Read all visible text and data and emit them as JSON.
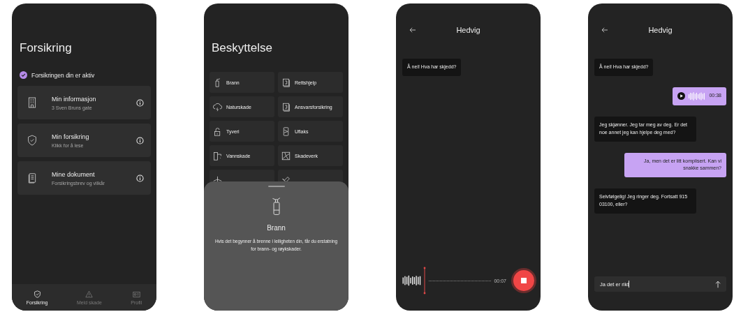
{
  "insurance_screen": {
    "title": "Forsikring",
    "status": {
      "label": "Forsikringen din er aktiv",
      "active": true
    },
    "cards": [
      {
        "title": "Min informasjon",
        "subtitle": "3 Sven Bruns gate"
      },
      {
        "title": "Min forsikring",
        "subtitle": "Klikk for å lese"
      },
      {
        "title": "Mine dokument",
        "subtitle": "Forsikringsbrev og vilkår"
      }
    ],
    "tabs": [
      {
        "label": "Forsikring",
        "selected": true
      },
      {
        "label": "Meld skade",
        "selected": false
      },
      {
        "label": "Profil",
        "selected": false
      }
    ]
  },
  "protection_screen": {
    "title": "Beskyttelse",
    "tiles": [
      {
        "label": "Brann"
      },
      {
        "label": "Rettshjelp"
      },
      {
        "label": "Naturskade"
      },
      {
        "label": "Ansvarsforsikring"
      },
      {
        "label": "Tyveri"
      },
      {
        "label": "Uflaks"
      },
      {
        "label": "Vannskade"
      },
      {
        "label": "Skadeverk"
      }
    ],
    "sheet": {
      "title": "Brann",
      "description": "Hvis det begynner å brenne i leiligheten din, får du erstatning for brann- og røykskader."
    }
  },
  "recording_screen": {
    "title": "Hedvig",
    "messages": [
      {
        "text": "Å nei! Hva har skjedd?"
      }
    ],
    "elapsed": "00:07"
  },
  "chat_screen": {
    "title": "Hedvig",
    "messages": [
      {
        "outgoing": false,
        "kind": "text",
        "text": "Å nei! Hva har skjedd?"
      },
      {
        "outgoing": true,
        "kind": "voice",
        "text": "00:38"
      },
      {
        "outgoing": false,
        "kind": "text",
        "text": "Jeg skjønner. Jeg tar meg av deg. Er det noe annet jeg kan hjelpe deg med?"
      },
      {
        "outgoing": true,
        "kind": "text",
        "text": "Ja, men det er litt komplisert. Kan vi snakke sammen?"
      },
      {
        "outgoing": false,
        "kind": "text",
        "text": "Selvfølgelig! Jeg ringer deg. Fortsatt 915 03100, eller?"
      }
    ],
    "input": {
      "value": "Ja det er rikt"
    }
  }
}
